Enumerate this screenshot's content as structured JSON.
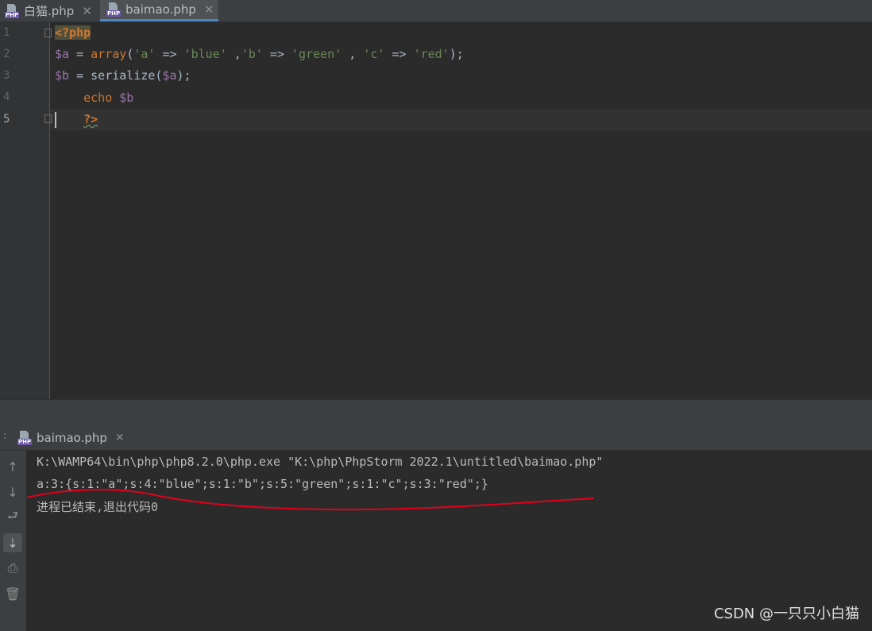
{
  "tabs": [
    {
      "label": "白猫.php",
      "active": false
    },
    {
      "label": "baimao.php",
      "active": true
    }
  ],
  "icons": {
    "file": "php-file-icon",
    "close": "close-icon"
  },
  "editor": {
    "line_numbers": [
      "1",
      "2",
      "3",
      "4",
      "5"
    ],
    "lines": [
      "<?php",
      "$a = array('a' => 'blue' ,'b' => 'green' , 'c' => 'red');",
      "$b = serialize($a);",
      "    echo $b",
      "    ?>"
    ]
  },
  "run": {
    "tab_label": "baimao.php",
    "output": [
      "K:\\WAMP64\\bin\\php\\php8.2.0\\php.exe \"K:\\php\\PhpStorm 2022.1\\untitled\\baimao.php\"",
      "a:3:{s:1:\"a\";s:4:\"blue\";s:1:\"b\";s:5:\"green\";s:1:\"c\";s:3:\"red\";}",
      "进程已结束,退出代码0"
    ]
  },
  "watermark": "CSDN @一只只小白猫",
  "colors": {
    "accent": "#4a88c7",
    "annotation": "#e3001b"
  }
}
